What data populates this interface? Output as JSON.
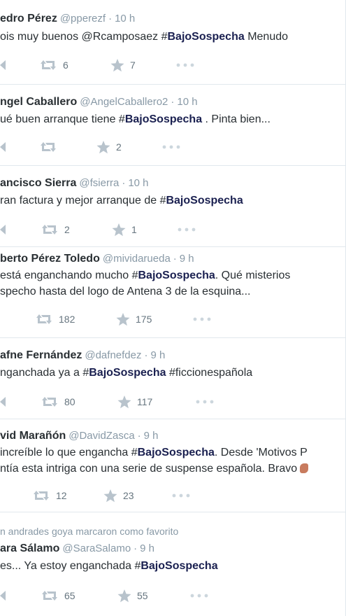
{
  "tweets": [
    {
      "name": "edro Pérez",
      "handle": "@pperezf",
      "time": "10 h",
      "text_pre": "ois muy buenos @Rcamposaez ",
      "hashtag": "BajoSospecha",
      "text_post": " Menudo",
      "retweets": "6",
      "favorites": "7"
    },
    {
      "name": "ngel Caballero",
      "handle": "@AngelCaballero2",
      "time": "10 h",
      "text_pre": "ué buen arranque tiene ",
      "hashtag": "BajoSospecha",
      "text_post": " . Pinta bien...",
      "retweets": "",
      "favorites": "2"
    },
    {
      "name": "ancisco Sierra",
      "handle": "@fsierra",
      "time": "10 h",
      "text_pre": "ran factura y mejor arranque de ",
      "hashtag": "BajoSospecha",
      "text_post": "",
      "retweets": "2",
      "favorites": "1"
    },
    {
      "name": "berto Pérez Toledo",
      "handle": "@mividarueda",
      "time": "9 h",
      "text_pre": " está enganchando mucho ",
      "hashtag": "BajoSospecha",
      "text_post": ". Qué misterios",
      "text_line2": "specho hasta del logo de Antena 3 de la esquina...",
      "retweets": "182",
      "favorites": "175"
    },
    {
      "name": "afne Fernández",
      "handle": "@dafnefdez",
      "time": "9 h",
      "text_pre": "nganchada ya a ",
      "hashtag": "BajoSospecha",
      "text_post": " #ficcionespañola",
      "retweets": "80",
      "favorites": "117"
    },
    {
      "name": "vid Marañón",
      "handle": "@DavidZasca",
      "time": "9 h",
      "text_pre": "increíble lo que engancha ",
      "hashtag": "BajoSospecha",
      "text_post": ". Desde 'Motivos P",
      "text_line2": "ntía esta intriga con una serie de suspense española. Bravo",
      "retweets": "12",
      "favorites": "23"
    },
    {
      "context": "n andrades goya marcaron como favorito",
      "name": "ara Sálamo",
      "handle": "@SaraSalamo",
      "time": "9 h",
      "text_pre": "es... Ya estoy enganchada ",
      "hashtag": "BajoSospecha",
      "text_post": "",
      "retweets": "65",
      "favorites": "55"
    }
  ],
  "separator": "·",
  "hash_symbol": "#",
  "more_icon": "more-dots-icon",
  "retweet_icon": "retweet-icon",
  "favorite_icon": "star-icon",
  "reply_icon": "reply-icon",
  "colors": {
    "text": "#292f33",
    "muted": "#8899a6",
    "hashtag": "#1a2050",
    "divider": "#e1e8ed"
  }
}
